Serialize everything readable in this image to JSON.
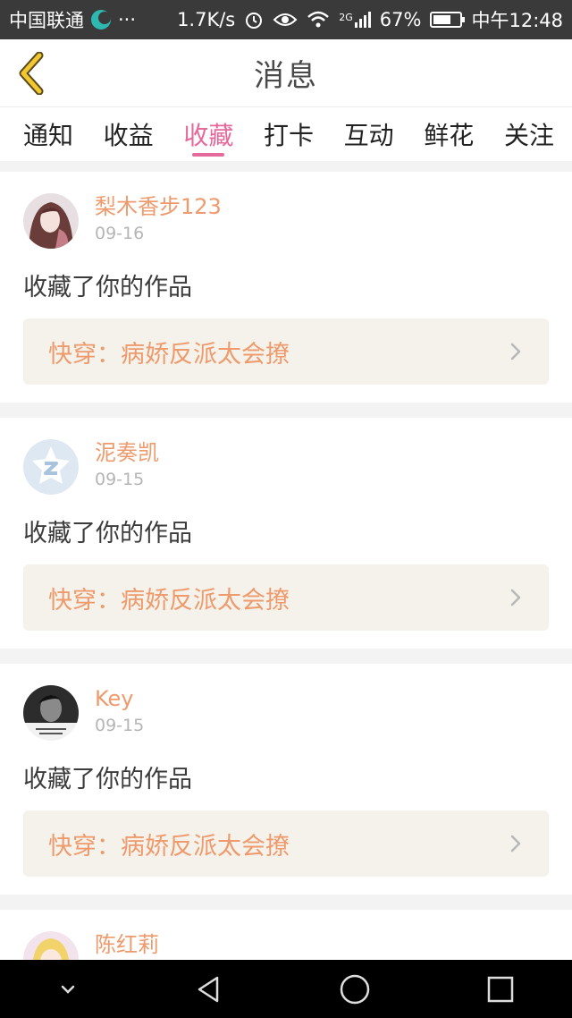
{
  "status_bar": {
    "carrier": "中国联通",
    "more": "···",
    "speed": "1.7K/s",
    "network": "2G",
    "battery": "67%",
    "battery_level": 0.67,
    "time": "中午12:48"
  },
  "header": {
    "title": "消息"
  },
  "tabs": [
    {
      "label": "通知"
    },
    {
      "label": "收益"
    },
    {
      "label": "收藏"
    },
    {
      "label": "打卡"
    },
    {
      "label": "互动"
    },
    {
      "label": "鲜花"
    },
    {
      "label": "关注"
    }
  ],
  "active_tab": "收藏",
  "feed": [
    {
      "user": "梨木香步123",
      "date": "09-16",
      "action": "收藏了你的作品",
      "work": "快穿：病娇反派太会撩"
    },
    {
      "user": "泥奏凯",
      "date": "09-15",
      "action": "收藏了你的作品",
      "work": "快穿：病娇反派太会撩"
    },
    {
      "user": "Key",
      "date": "09-15",
      "action": "收藏了你的作品",
      "work": "快穿：病娇反派太会撩"
    },
    {
      "user": "陈红莉"
    }
  ],
  "colors": {
    "accent": "#e6699b",
    "name": "#ee9a6c",
    "back_arrow": "#f2c832"
  },
  "icons": {
    "back": "back-arrow-icon",
    "chevron": "chevron-right-icon"
  }
}
